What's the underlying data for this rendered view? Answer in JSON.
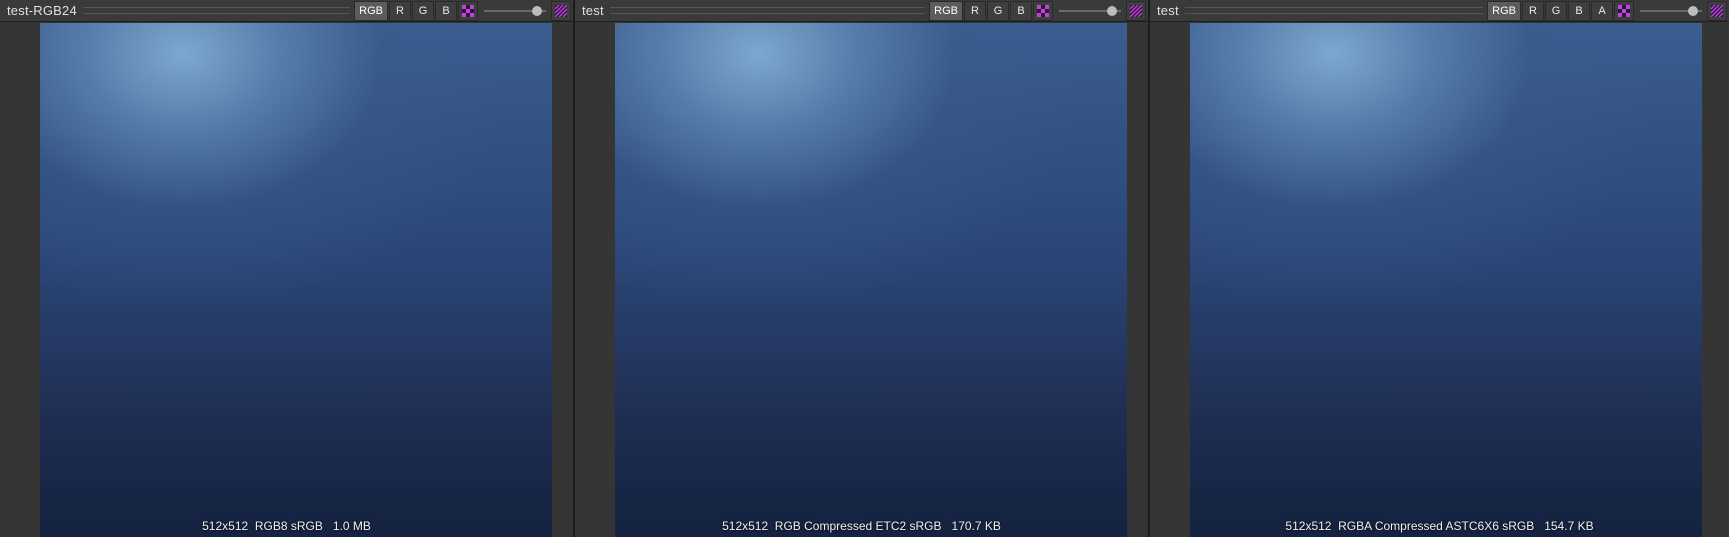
{
  "panels": [
    {
      "title": "test-RGB24",
      "channels": [
        "RGB",
        "R",
        "G",
        "B"
      ],
      "active_channel": "RGB",
      "exposure": 0.85,
      "info": "512x512  RGB8 sRGB   1.0 MB"
    },
    {
      "title": "test",
      "channels": [
        "RGB",
        "R",
        "G",
        "B"
      ],
      "active_channel": "RGB",
      "exposure": 0.85,
      "info": "512x512  RGB Compressed ETC2 sRGB   170.7 KB"
    },
    {
      "title": "test",
      "channels": [
        "RGB",
        "R",
        "G",
        "B",
        "A"
      ],
      "active_channel": "RGB",
      "exposure": 0.85,
      "info": "512x512  RGBA Compressed ASTC6X6 sRGB   154.7 KB"
    }
  ],
  "icons": {
    "checker": "checkerboard-icon",
    "hatch": "hatch-pattern-icon"
  },
  "colors": {
    "accent": "#c040e0"
  }
}
